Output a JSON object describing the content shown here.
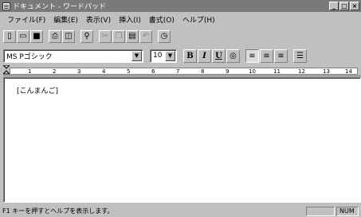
{
  "window": {
    "title": "ドキュメント - ワードパッド",
    "min_symbol": "_",
    "max_symbol": "□",
    "close_symbol": "×"
  },
  "menu": [
    {
      "label": "ファイル(F)"
    },
    {
      "label": "編集(E)"
    },
    {
      "label": "表示(V)"
    },
    {
      "label": "挿入(I)"
    },
    {
      "label": "書式(O)"
    },
    {
      "label": "ヘルプ(H)"
    }
  ],
  "toolbar": {
    "buttons": [
      {
        "icon": "new-document-icon",
        "glyph": "▯"
      },
      {
        "icon": "open-folder-icon",
        "glyph": "▭"
      },
      {
        "icon": "save-disk-icon",
        "glyph": "■"
      },
      {
        "icon": "print-icon",
        "glyph": "⎙"
      },
      {
        "icon": "print-preview-icon",
        "glyph": "◫"
      },
      {
        "icon": "find-binoculars-icon",
        "glyph": "⚲"
      },
      {
        "icon": "cut-scissors-icon",
        "glyph": "✂"
      },
      {
        "icon": "copy-icon",
        "glyph": "❐"
      },
      {
        "icon": "paste-clipboard-icon",
        "glyph": "▤"
      },
      {
        "icon": "undo-icon",
        "glyph": "↶"
      },
      {
        "icon": "insert-datetime-icon",
        "glyph": "◷"
      }
    ]
  },
  "format": {
    "font_name": "MS Pゴシック",
    "font_size": "10",
    "bold": "B",
    "italic": "I",
    "underline": "U",
    "color_icon": "color-palette-icon",
    "color_glyph": "◎",
    "align_left_glyph": "≡",
    "align_center_glyph": "≡",
    "align_right_glyph": "≡",
    "bullets_glyph": "☰",
    "dropdown_glyph": "▼"
  },
  "ruler": {
    "labels": [
      "1",
      "2",
      "3",
      "4",
      "5",
      "6",
      "7",
      "8",
      "9",
      "10",
      "11",
      "12",
      "13",
      "14"
    ]
  },
  "document": {
    "text": "[こんまんご]"
  },
  "status": {
    "message": "F1 キーを押すとヘルプを表示します。",
    "num": "NUM"
  }
}
